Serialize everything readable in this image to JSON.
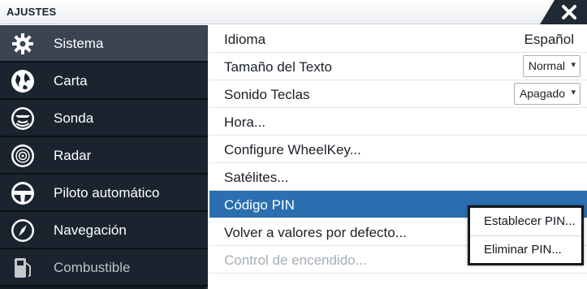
{
  "window": {
    "title": "AJUSTES",
    "close_icon": "close-icon"
  },
  "sidebar": {
    "items": [
      {
        "label": "Sistema",
        "icon": "gear-icon",
        "active": true
      },
      {
        "label": "Carta",
        "icon": "globe-icon"
      },
      {
        "label": "Sonda",
        "icon": "sonar-icon"
      },
      {
        "label": "Radar",
        "icon": "radar-icon"
      },
      {
        "label": "Piloto automático",
        "icon": "steering-wheel-icon"
      },
      {
        "label": "Navegación",
        "icon": "compass-icon"
      },
      {
        "label": "Combustible",
        "icon": "fuel-pump-icon",
        "partially_visible": true
      }
    ]
  },
  "settings": {
    "idioma": {
      "label": "Idioma",
      "value": "Español"
    },
    "tamano_texto": {
      "label": "Tamaño del Texto",
      "value": "Normal"
    },
    "sonido_teclas": {
      "label": "Sonido Teclas",
      "value": "Apagado"
    },
    "hora": {
      "label": "Hora..."
    },
    "wheelkey": {
      "label": "Configure WheelKey..."
    },
    "satelites": {
      "label": "Satélites..."
    },
    "codigo_pin": {
      "label": "Código PIN",
      "selected": true
    },
    "valores_defecto": {
      "label": "Volver a valores por defecto..."
    },
    "control_encendido": {
      "label": "Control de encendido...",
      "dimmed": true
    }
  },
  "pin_menu": {
    "items": [
      {
        "label": "Establecer PIN..."
      },
      {
        "label": "Eliminar PIN..."
      }
    ]
  },
  "colors": {
    "sidebar_bg": "#1b242e",
    "sidebar_active": "#3a4551",
    "selection_blue": "#2b6fb0",
    "title_dark": "#1f2a35"
  }
}
